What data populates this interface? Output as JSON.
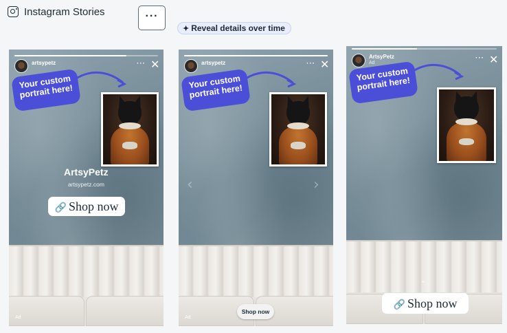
{
  "header": {
    "title": "Instagram Stories",
    "icon": "instagram-icon",
    "more_label": "···",
    "reveal_label": "Reveal details over time",
    "reveal_icon": "sparkle-icon"
  },
  "stories": [
    {
      "handle": "artsypetz",
      "caption_bubble": "Your custom portrait here!",
      "brand_name": "ArtsyPetz",
      "domain": "artsypetz.com",
      "cta": "Shop now",
      "ad_label": "Ad",
      "progress": 0.78
    },
    {
      "handle": "artsypetz",
      "caption_bubble": "Your custom portrait here!",
      "cta": "Shop now",
      "ad_label": "Ad",
      "progress": 1.0
    },
    {
      "handle": "ArtsyPetz",
      "sub": "Ad",
      "caption_bubble": "Your custom portrait here!",
      "cta": "Shop now",
      "progress": 0.45
    }
  ],
  "colors": {
    "bubble": "#4b4fd8",
    "reveal_bg": "#e8edff",
    "link": "#3b82f6"
  }
}
